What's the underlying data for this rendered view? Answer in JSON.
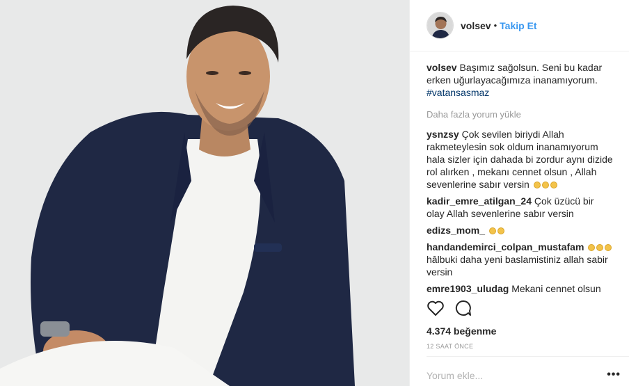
{
  "post": {
    "username": "volsev",
    "dot": "•",
    "follow_label": "Takip Et",
    "caption_user": "volsev",
    "caption_text": "Başımız sağolsun. Seni bu kadar erken uğurlayacağımıza inanamıyorum.",
    "caption_tag": "#vatansasmaz",
    "load_more": "Daha fazla yorum yükle",
    "likes": "4.374 beğenme",
    "time": "12 SAAT ÖNCE",
    "comment_placeholder": "Yorum ekle...",
    "more_dots": "•••"
  },
  "comments": [
    {
      "user": "ysnzsy",
      "text": "Çok sevilen biriydi Allah rakmeteylesin sok oldum inanamıyorum hala sizler için dahada bi zordur aynı dizide rol alırken , mekanı cennet olsun , Allah sevenlerine sabır versin",
      "emoji": 3
    },
    {
      "user": "kadir_emre_atilgan_24",
      "text": "Çok üzücü bir olay Allah sevenlerine sabır versin",
      "emoji": 0
    },
    {
      "user": "edizs_mom_",
      "text": "",
      "emoji": 2
    },
    {
      "user": "handandemirci_colpan_mustafam",
      "text": "hâlbuki daha yeni baslamistiniz allah sabir versin",
      "emoji": 3
    },
    {
      "user": "emre1903_uludag",
      "text": "Mekani cennet olsun @volsev abim",
      "emoji": 0
    }
  ],
  "colors": {
    "link": "#3897f0",
    "tag": "#003569",
    "muted": "#999999"
  },
  "icons": [
    "heart-icon",
    "comment-icon"
  ]
}
